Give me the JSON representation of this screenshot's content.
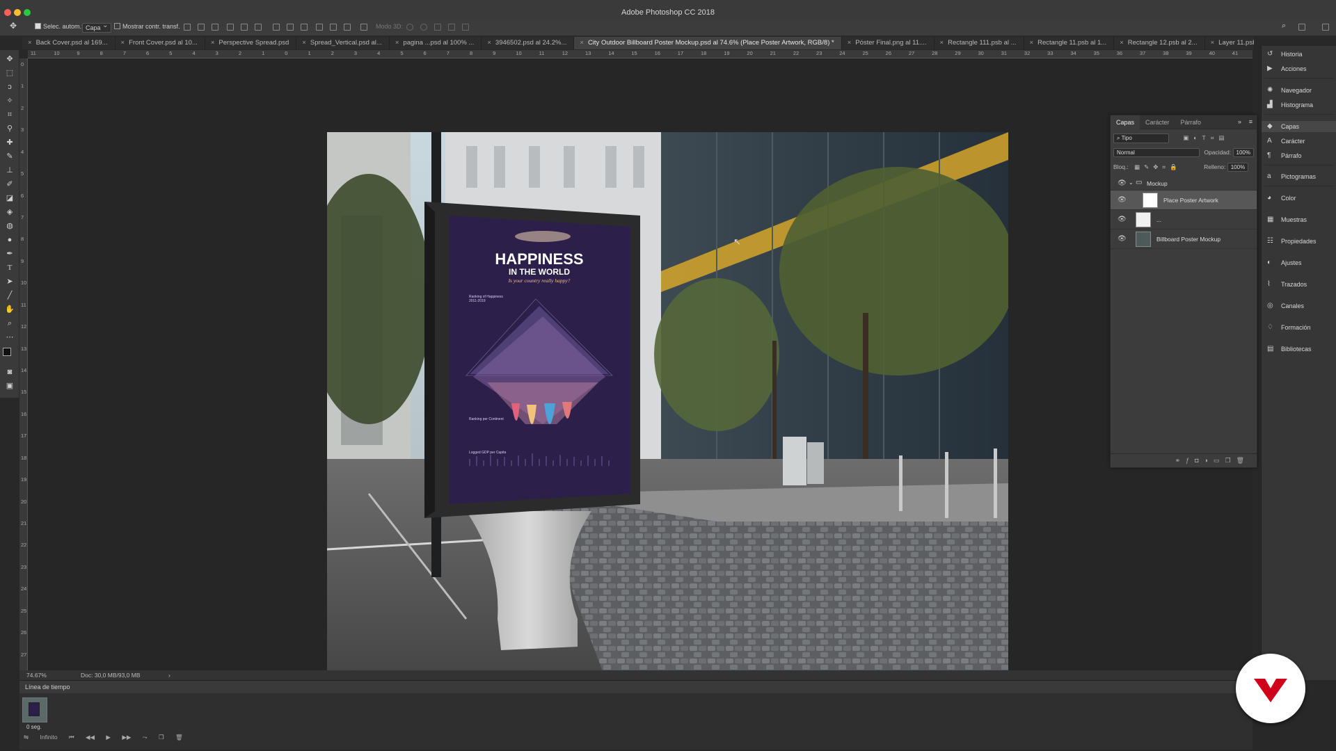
{
  "window": {
    "title": "Adobe Photoshop CC 2018"
  },
  "options_bar": {
    "auto_select_label": "Selec. autom.:",
    "auto_select_value": "Capa",
    "show_transform_label": "Mostrar contr. transf.",
    "mode_3d_label": "Modo 3D:"
  },
  "tabs": [
    {
      "label": "Back Cover.psd al 169...",
      "active": false
    },
    {
      "label": "Front Cover.psd al 10...",
      "active": false
    },
    {
      "label": "Perspective Spread.psd",
      "active": false
    },
    {
      "label": "Spread_Vertical.psd al...",
      "active": false
    },
    {
      "label": "pagina ...psd al 100% ...",
      "active": false
    },
    {
      "label": "3946502.psd al 24.2%...",
      "active": false
    },
    {
      "label": "City Outdoor Billboard Poster Mockup.psd al 74.6% (Place Poster Artwork, RGB/8) *",
      "active": true
    },
    {
      "label": "Póster Final.png al 11....",
      "active": false
    },
    {
      "label": "Rectangle 111.psb al ...",
      "active": false
    },
    {
      "label": "Rectangle 11.psb al 1...",
      "active": false
    },
    {
      "label": "Rectangle 12.psb al 2...",
      "active": false
    },
    {
      "label": "Layer 11.psb al 100% ...",
      "active": false
    }
  ],
  "ruler_top": [
    "11",
    "10",
    "9",
    "8",
    "7",
    "6",
    "5",
    "4",
    "3",
    "2",
    "1",
    "0",
    "1",
    "2",
    "3",
    "4",
    "5",
    "6",
    "7",
    "8",
    "9",
    "10",
    "11",
    "12",
    "13",
    "14",
    "15",
    "16",
    "17",
    "18",
    "19",
    "20",
    "21",
    "22",
    "23",
    "24",
    "25",
    "26",
    "27",
    "28",
    "29",
    "30",
    "31",
    "32",
    "33",
    "34",
    "35",
    "36",
    "37",
    "38",
    "39",
    "40",
    "41"
  ],
  "ruler_left": [
    "0",
    "1",
    "2",
    "3",
    "4",
    "5",
    "6",
    "7",
    "8",
    "9",
    "10",
    "11",
    "12",
    "13",
    "14",
    "15",
    "16",
    "17",
    "18",
    "19",
    "20",
    "21",
    "22",
    "23",
    "24",
    "25",
    "26",
    "27"
  ],
  "poster": {
    "title_line1": "HAPPINESS",
    "title_line2": "IN THE WORLD",
    "subtitle": "Is your country really happy?",
    "section1": "Ranking of Happiness",
    "section1_years": "2011-2019",
    "section2": "Ranking per Continent",
    "section3": "Logged GDP per Capita"
  },
  "status": {
    "zoom": "74.67%",
    "doc": "Doc: 30,0 MB/93,0 MB"
  },
  "timeline": {
    "header": "Línea de tiempo",
    "frame_duration": "0 seg.",
    "loop": "Infinito"
  },
  "layers_panel": {
    "tabs": [
      {
        "label": "Capas",
        "active": true
      },
      {
        "label": "Carácter",
        "active": false
      },
      {
        "label": "Párrafo",
        "active": false
      }
    ],
    "filter": "Tipo",
    "blend_mode": "Normal",
    "opacity_label": "Opacidad:",
    "opacity_value": "100%",
    "lock_label": "Bloq.:",
    "fill_label": "Relleno:",
    "fill_value": "100%",
    "layers": [
      {
        "name": "Mockup",
        "type": "group",
        "selected": false
      },
      {
        "name": "Place Poster Artwork",
        "type": "smart",
        "selected": true
      },
      {
        "name": "...",
        "type": "layer",
        "selected": false
      },
      {
        "name": "Billboard Poster Mockup",
        "type": "image",
        "selected": false
      }
    ]
  },
  "dock": [
    {
      "label": "Historia",
      "icon": "history-icon"
    },
    {
      "label": "Acciones",
      "icon": "actions-icon"
    },
    {
      "label": "Navegador",
      "icon": "navigator-icon"
    },
    {
      "label": "Histograma",
      "icon": "histogram-icon"
    },
    {
      "label": "Capas",
      "icon": "layers-icon",
      "active": true
    },
    {
      "label": "Carácter",
      "icon": "character-icon"
    },
    {
      "label": "Párrafo",
      "icon": "paragraph-icon"
    },
    {
      "label": "Pictogramas",
      "icon": "glyphs-icon"
    },
    {
      "label": "Color",
      "icon": "color-icon"
    },
    {
      "label": "Muestras",
      "icon": "swatches-icon"
    },
    {
      "label": "Propiedades",
      "icon": "properties-icon"
    },
    {
      "label": "Ajustes",
      "icon": "adjustments-icon"
    },
    {
      "label": "Trazados",
      "icon": "paths-icon"
    },
    {
      "label": "Canales",
      "icon": "channels-icon"
    },
    {
      "label": "Formación",
      "icon": "learn-icon"
    },
    {
      "label": "Bibliotecas",
      "icon": "libraries-icon"
    }
  ],
  "colors": {
    "accent_badge": "#d0021b",
    "poster_bg": "#2c1f4a"
  }
}
